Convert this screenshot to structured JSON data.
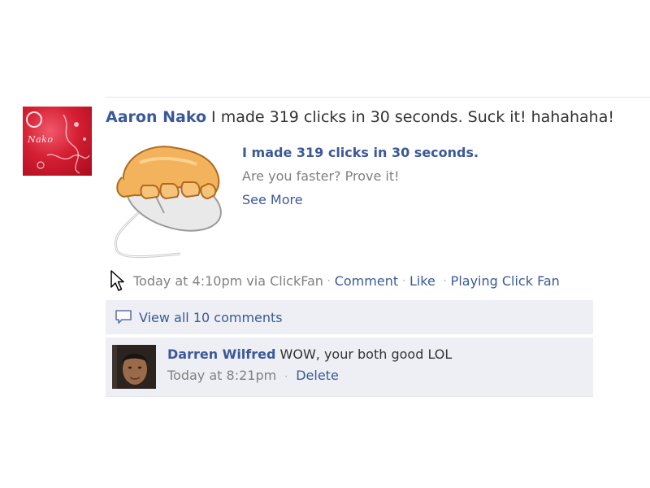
{
  "post": {
    "author": "Aaron Nako",
    "message": "I made 319 clicks in 30 seconds. Suck it! hahahaha!",
    "avatar_text": "Nako",
    "attachment": {
      "title": "I made 319 clicks in 30 seconds.",
      "description": "Are you faster? Prove it!",
      "more_link": "See More",
      "image_icon": "hand-on-mouse-icon"
    },
    "meta": {
      "timestamp": "Today at 4:10pm via ClickFan",
      "separator": "·",
      "comment_link": "Comment",
      "like_link": "Like",
      "app_link": "Playing Click Fan"
    }
  },
  "comments": {
    "view_all_label": "View all 10 comments",
    "items": [
      {
        "author": "Darren Wilfred",
        "text": "WOW, your both good LOL",
        "timestamp": "Today at 8:21pm",
        "delete_label": "Delete"
      }
    ]
  },
  "colors": {
    "link": "#3b5998",
    "muted": "#808080",
    "comment_bg": "#edeff4"
  }
}
